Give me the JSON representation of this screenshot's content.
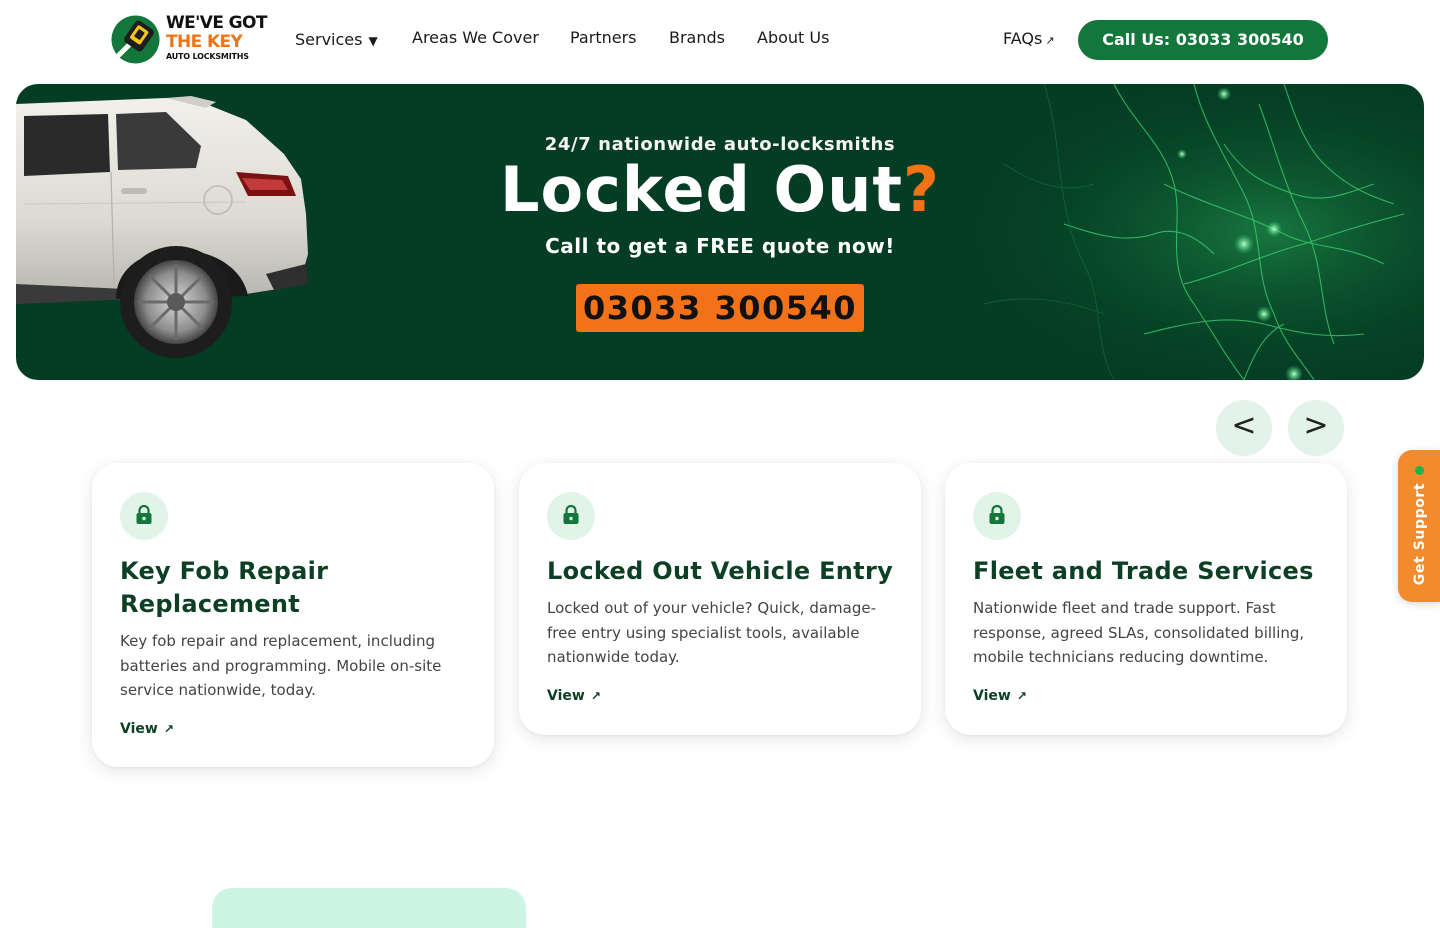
{
  "header": {
    "logo": {
      "line1": "WE'VE GOT",
      "line2": "THE KEY",
      "line3": "AUTO LOCKSMITHS"
    },
    "nav": [
      {
        "label": "Services",
        "caret": "▼"
      },
      {
        "label": "Areas We Cover"
      },
      {
        "label": "Partners"
      },
      {
        "label": "Brands"
      },
      {
        "label": "About Us"
      }
    ],
    "faqs": {
      "label": "FAQs",
      "arrow": "↗"
    },
    "call_button": "Call Us: 03033 300540"
  },
  "hero": {
    "kicker": "24/7 nationwide auto-locksmiths",
    "title": "Locked Out",
    "title_mark": "?",
    "subtitle": "Call to get a FREE quote now!",
    "phone": "03033 300540"
  },
  "carousel": {
    "prev": "<",
    "next": ">",
    "cards": [
      {
        "icon": "lock-icon",
        "title": "Key Fob Repair Replacement",
        "description": "Key fob repair and replacement, including batteries and programming. Mobile on-site service nationwide, today.",
        "link": "View",
        "link_arrow": "↗"
      },
      {
        "icon": "lock-icon",
        "title": "Locked Out Vehicle Entry",
        "description": "Locked out of your vehicle? Quick, damage-free entry using specialist tools, available nationwide today.",
        "link": "View",
        "link_arrow": "↗"
      },
      {
        "icon": "lock-icon",
        "title": "Fleet and Trade Services",
        "description": "Nationwide fleet and trade support. Fast response, agreed SLAs, consolidated billing, mobile technicians reducing downtime.",
        "link": "View",
        "link_arrow": "↗"
      }
    ]
  },
  "support_tab": {
    "label": "Get Support"
  },
  "colors": {
    "brand_green": "#13763a",
    "hero_bg": "#053d24",
    "accent_orange": "#f07416",
    "card_title": "#0d3f25",
    "support_tab": "#f28a2e"
  }
}
